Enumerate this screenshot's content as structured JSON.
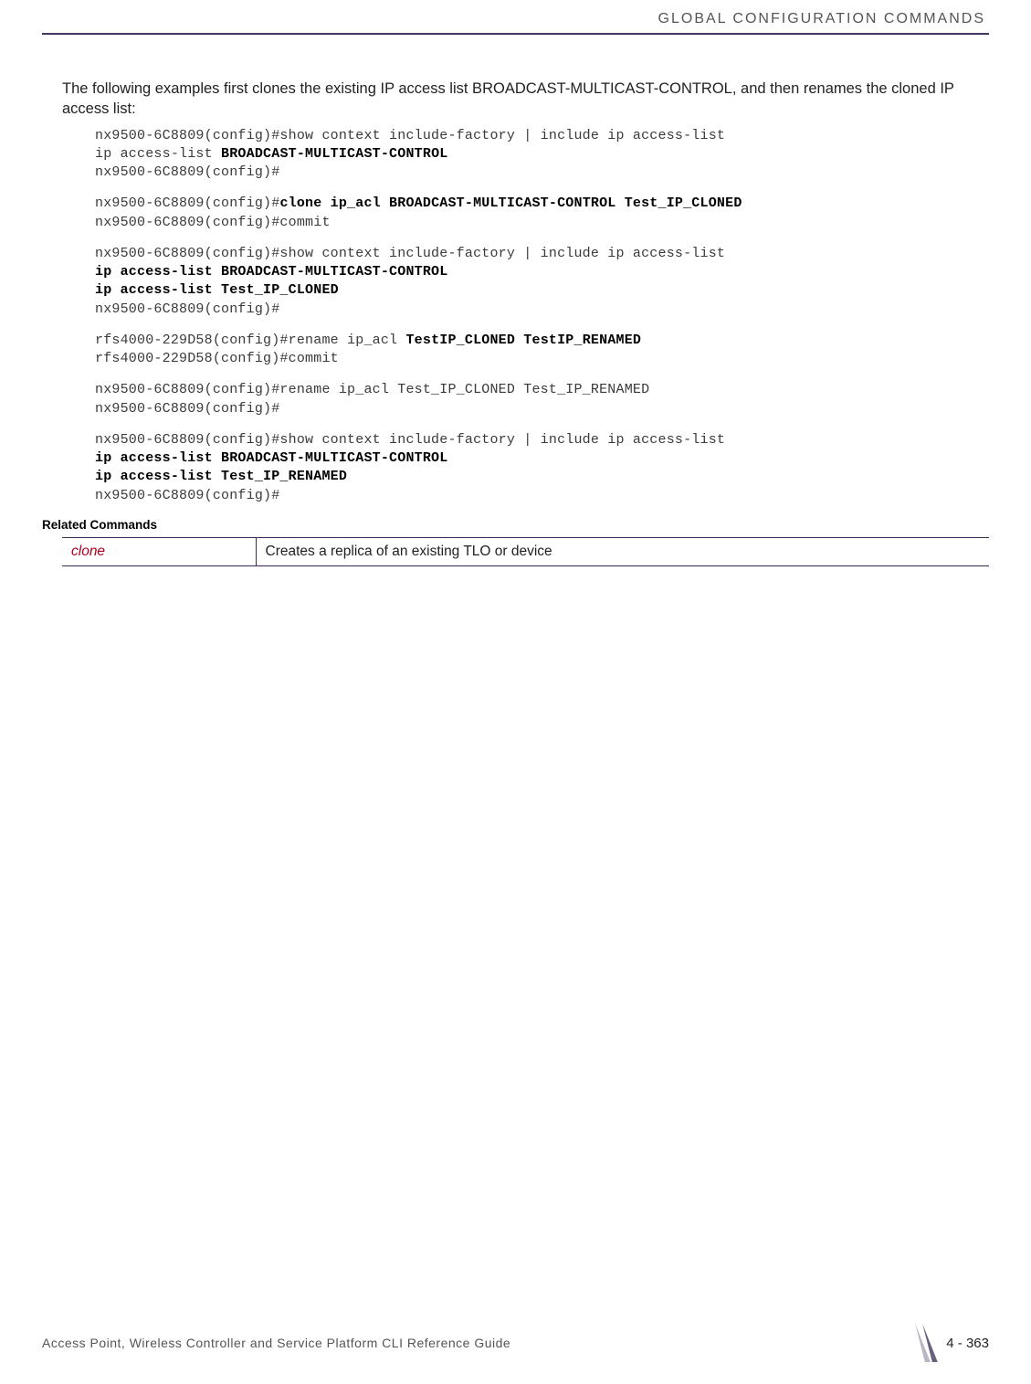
{
  "header": {
    "section_title": "GLOBAL CONFIGURATION COMMANDS"
  },
  "body": {
    "intro": "The following examples first clones the existing IP access list BROADCAST-MULTICAST-CONTROL, and then renames the cloned IP access list:"
  },
  "code": {
    "b1_l1": "nx9500-6C8809(config)#show context include-factory | include ip access-list",
    "b1_l2a": "ip access-list ",
    "b1_l2b": "BROADCAST-MULTICAST-CONTROL",
    "b1_l3": "nx9500-6C8809(config)#",
    "b2_l1a": "nx9500-6C8809(config)#",
    "b2_l1b": "clone ip_acl BROADCAST-MULTICAST-CONTROL Test_IP_CLONED",
    "b2_l2": "nx9500-6C8809(config)#commit",
    "b3_l1": "nx9500-6C8809(config)#show context include-factory | include ip access-list",
    "b3_l2": "ip access-list BROADCAST-MULTICAST-CONTROL",
    "b3_l3": "ip access-list Test_IP_CLONED",
    "b3_l4": "nx9500-6C8809(config)#",
    "b4_l1a": "rfs4000-229D58(config)#rename ip_acl ",
    "b4_l1b": "TestIP_CLONED TestIP_RENAMED",
    "b4_l2": "rfs4000-229D58(config)#commit",
    "b5_l1": "nx9500-6C8809(config)#rename ip_acl Test_IP_CLONED Test_IP_RENAMED",
    "b5_l2": "nx9500-6C8809(config)#",
    "b6_l1": "nx9500-6C8809(config)#show context include-factory | include ip access-list",
    "b6_l2": "ip access-list BROADCAST-MULTICAST-CONTROL",
    "b6_l3": "ip access-list Test_IP_RENAMED",
    "b6_l4": "nx9500-6C8809(config)#"
  },
  "related": {
    "heading": "Related Commands",
    "rows": [
      {
        "cmd": "clone",
        "desc": "Creates a replica of an existing TLO or device"
      }
    ]
  },
  "footer": {
    "doc_title": "Access Point, Wireless Controller and Service Platform CLI Reference Guide",
    "page": "4 - 363"
  }
}
